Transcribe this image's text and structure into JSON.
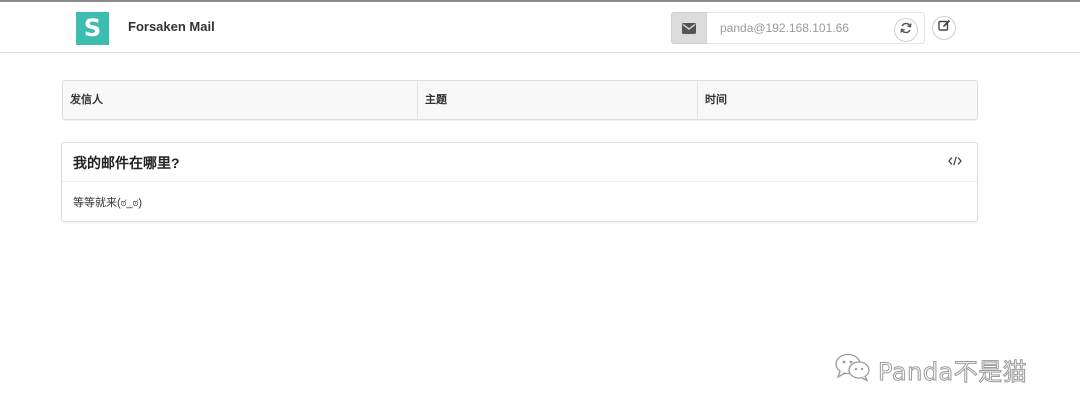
{
  "app": {
    "logo_letter": "S",
    "name": "Forsaken Mail"
  },
  "header": {
    "address_value": "panda@192.168.101.66",
    "address_icon": "envelope-icon",
    "refresh_icon": "refresh-icon",
    "compose_icon": "edit-icon"
  },
  "table": {
    "columns": [
      "发信人",
      "主题",
      "时间"
    ]
  },
  "message": {
    "title": "我的邮件在哪里?",
    "body": "等等就来(ಠ_ಠ)",
    "code_icon": "code-icon"
  },
  "watermark": {
    "text": "Panda不是猫",
    "icon": "wechat-icon"
  },
  "colors": {
    "logo": "#3dbdb0",
    "addon": "#dcdcdc",
    "header_bg": "#f8f8f8"
  }
}
